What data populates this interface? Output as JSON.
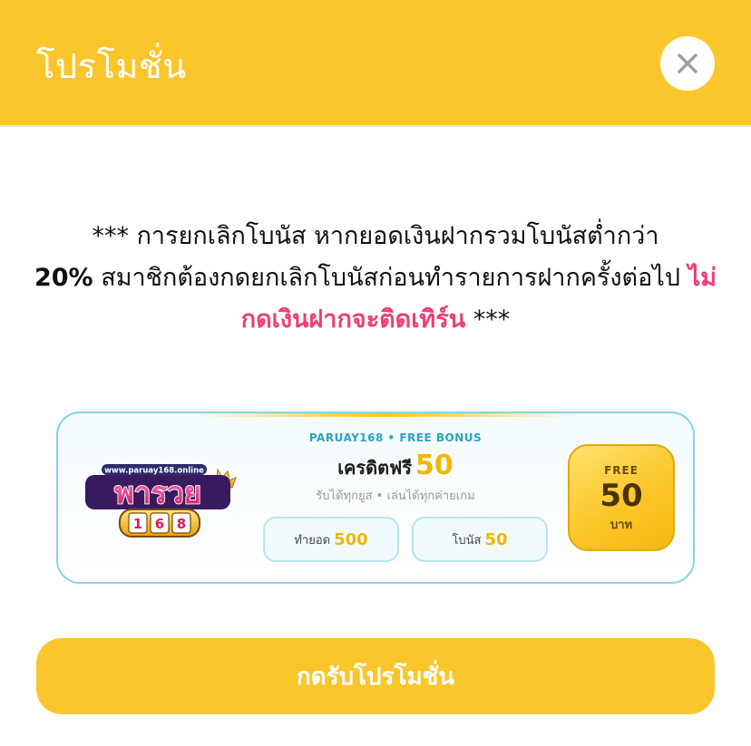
{
  "header": {
    "title": "โปรโมชั่น"
  },
  "notice": {
    "prefix": "*** การยกเลิกโบนัส หากยอดเงินฝากรวมโบนัสต่ำกว่า",
    "percent": "20%",
    "middle": "สมาชิกต้องกดยกเลิกโบนัสก่อนทำรายการฝากครั้งต่อไป",
    "warning": "ไม่กดเงินฝากจะติดเทิร์น",
    "suffix": "***"
  },
  "card": {
    "logo": {
      "url_text": "www.paruay168.online",
      "name_text": "พารวย",
      "num_text": "168"
    },
    "tagline": "PARUAY168 • FREE BONUS",
    "credit_label": "เครดิตฟรี",
    "credit_amount": "50",
    "subline": "รับได้ทุกยูส • เล่นได้ทุกค่ายเกม",
    "pills": [
      {
        "label": "ทำยอด",
        "value": "500"
      },
      {
        "label": "โบนัส",
        "value": "50"
      }
    ],
    "badge": {
      "top": "FREE",
      "amount": "50",
      "unit": "บาท"
    }
  },
  "cta": {
    "label": "กดรับโปรโมชั่น"
  },
  "colors": {
    "primary": "#fbc62b",
    "warning": "#f03e73",
    "accent_blue": "#2aa3c6",
    "gold_text": "#f2b705"
  },
  "icons": {
    "close": "close-icon"
  }
}
